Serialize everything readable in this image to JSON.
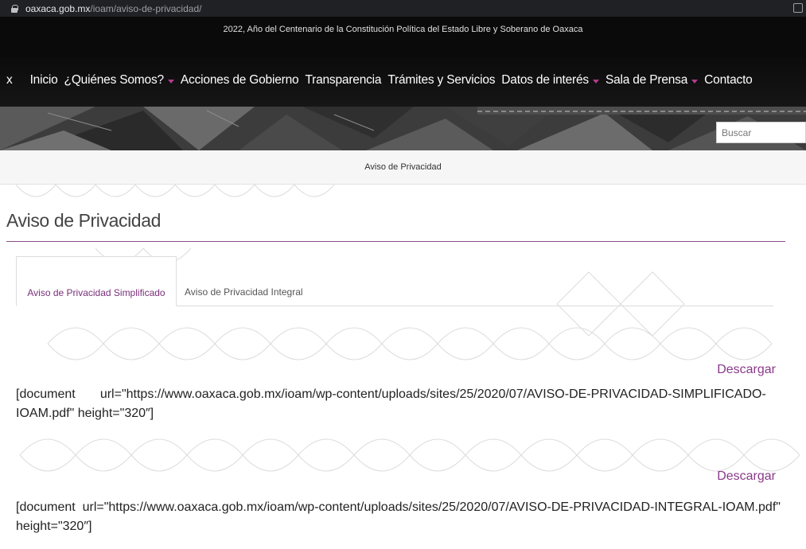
{
  "browser": {
    "host": "oaxaca.gob.mx",
    "path": "/ioam/aviso-de-privacidad/"
  },
  "announcement": "2022, Año del Centenario de la Constitución Política del Estado Libre y Soberano de Oaxaca",
  "nav": {
    "items": [
      {
        "label": "x"
      },
      {
        "label": "Inicio"
      },
      {
        "label": "¿Quiénes Somos?"
      },
      {
        "label": "Acciones de Gobierno"
      },
      {
        "label": "Transparencia"
      },
      {
        "label": "Trámites y Servicios"
      },
      {
        "label": "Datos de interés"
      },
      {
        "label": "Sala de Prensa"
      },
      {
        "label": "Contacto"
      }
    ],
    "caret_color": "#b33b8a"
  },
  "search": {
    "placeholder": "Buscar"
  },
  "breadcrumb": "Aviso de Privacidad",
  "page": {
    "title": "Aviso de Privacidad",
    "tabs": [
      {
        "label": "Aviso de Privacidad Simplificado"
      },
      {
        "label": "Aviso de Privacidad Integral"
      }
    ],
    "documents": [
      {
        "download_label": "Descargar",
        "line1": "[document       url=\"https://www.oaxaca.gob.mx/ioam/wp-content/uploads/sites/25/2020/07/AVISO-DE-PRIVACIDAD-SIMPLIFICADO-",
        "line2": "IOAM.pdf\" height=\"320″]"
      },
      {
        "download_label": "Descargar",
        "line1": "[document  url=\"https://www.oaxaca.gob.mx/ioam/wp-content/uploads/sites/25/2020/07/AVISO-DE-PRIVACIDAD-INTEGRAL-IOAM.pdf\"",
        "line2": "height=\"320″]"
      }
    ]
  },
  "colors": {
    "accent": "#8a3a8a",
    "nav_bg": "#111111"
  }
}
